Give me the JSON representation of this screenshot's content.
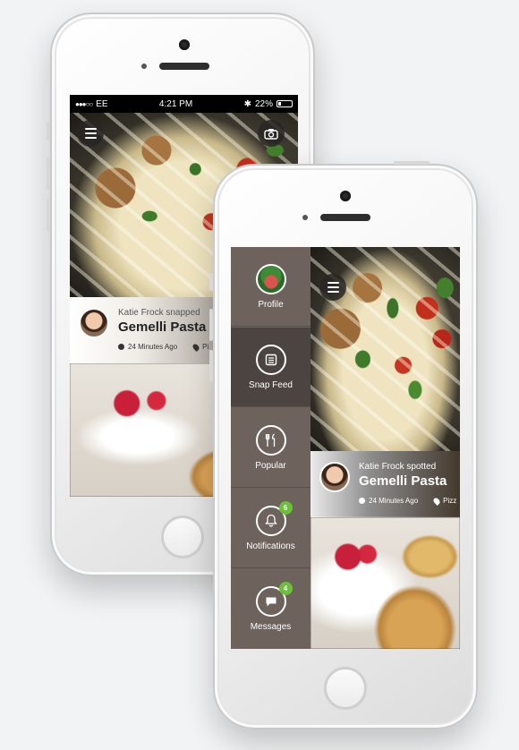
{
  "back_phone": {
    "status": {
      "carrier": "EE",
      "time": "4:21 PM",
      "battery": "22%"
    },
    "post": {
      "author_action": "Katie Frock snapped",
      "dish": "Gemelli Pasta",
      "time_ago": "24 Minutes Ago",
      "location": "Pi"
    },
    "icons": {
      "menu": "hamburger-menu-icon",
      "camera": "camera-icon"
    }
  },
  "front_phone": {
    "sidebar": {
      "items": [
        {
          "label": "Profile",
          "icon": "profile-avatar"
        },
        {
          "label": "Snap Feed",
          "icon": "list-icon",
          "active": true
        },
        {
          "label": "Popular",
          "icon": "fork-knife-icon"
        },
        {
          "label": "Notifications",
          "icon": "bell-icon",
          "badge": "6"
        },
        {
          "label": "Messages",
          "icon": "chat-icon",
          "badge": "4"
        }
      ]
    },
    "post": {
      "author_action": "Katie Frock spotted",
      "dish": "Gemelli Pasta",
      "time_ago": "24 Minutes Ago",
      "location": "Pizz"
    }
  },
  "colors": {
    "sidebar": "#6d625c",
    "sidebar_active": "#4b4440",
    "badge": "#6bbf3a"
  }
}
